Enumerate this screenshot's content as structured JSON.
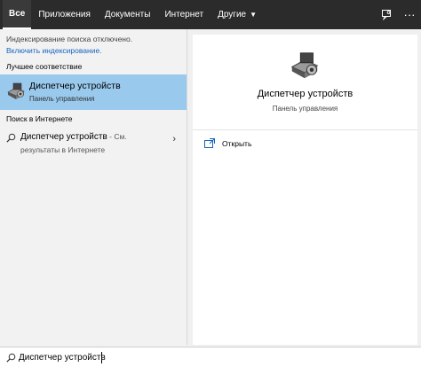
{
  "tabs": [
    {
      "label": "Все"
    },
    {
      "label": "Приложения"
    },
    {
      "label": "Документы"
    },
    {
      "label": "Интернет"
    },
    {
      "label": "Другие"
    }
  ],
  "left": {
    "notice_text": "Индексирование поиска отключено.",
    "notice_link": "Включить индексирование.",
    "best_match_heading": "Лучшее соответствие",
    "best_match": {
      "title": "Диспетчер устройств",
      "subtitle": "Панель управления",
      "icon": "device-manager-icon"
    },
    "web_heading": "Поиск в Интернете",
    "web_result": {
      "query": "Диспетчер устройств",
      "suffix": " - См.",
      "line2": "результаты в Интернете"
    }
  },
  "right": {
    "title": "Диспетчер устройств",
    "subtitle": "Панель управления",
    "open_label": "Открыть"
  },
  "search": {
    "value": "Диспетчер устройств"
  },
  "colors": {
    "topbar": "#2b2b2b",
    "selected": "#99c9ec",
    "link": "#1565c0"
  }
}
